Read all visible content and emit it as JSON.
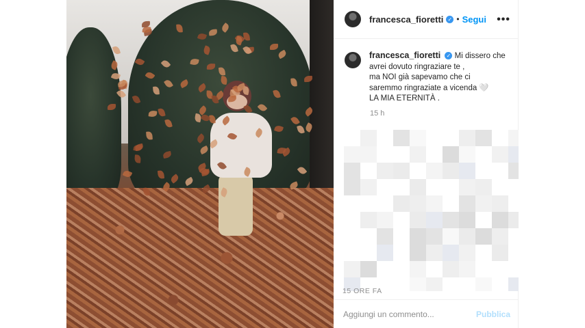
{
  "post": {
    "username": "francesca_fioretti",
    "follow_label": "Segui",
    "dot": "•",
    "more_label": "•••",
    "verified_mark": "✓",
    "caption_lines": [
      "Mi dissero che",
      "avrei dovuto ringraziare te ,",
      "ma NOI già sapevamo che ci",
      "saremmo ringraziate a vicenda 🤍",
      "LA MIA ETERNITÀ ."
    ],
    "caption_time": "15 h",
    "post_time": "15 ORE FA"
  },
  "comment_box": {
    "placeholder": "Aggiungi un commento...",
    "publish_label": "Pubblica"
  },
  "colors": {
    "accent": "#0095f6",
    "verified": "#3897f0",
    "publish_disabled": "#b2dffc",
    "secondary_text": "#8e8e8e"
  },
  "icons": [
    "verified-badge-icon",
    "more-options-icon"
  ]
}
